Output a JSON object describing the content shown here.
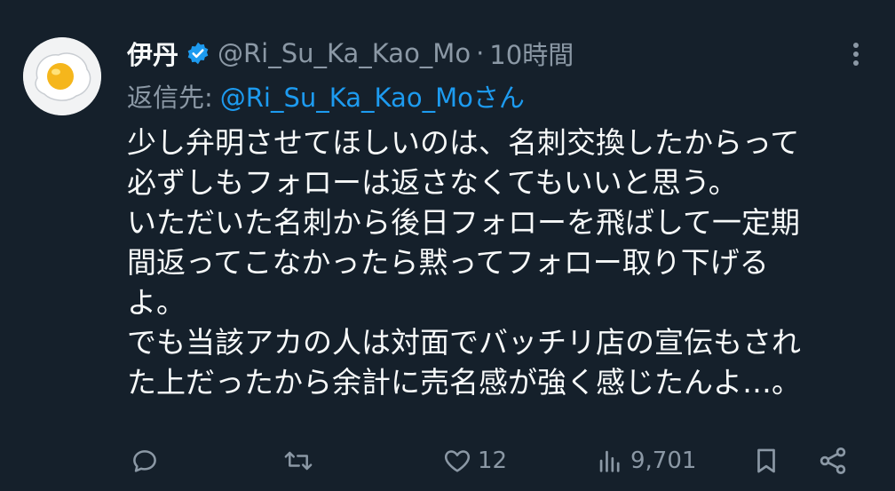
{
  "tweet": {
    "display_name": "伊丹",
    "verified_icon": "verified-badge-icon",
    "handle": "@Ri_Su_Ka_Kao_Mo",
    "separator": "·",
    "time": "10時間",
    "replying_label": "返信先:",
    "replying_handle": "@Ri_Su_Ka_Kao_Moさん",
    "body_lines": [
      "少し弁明させてほしいのは、名刺交換したからって",
      "必ずしもフォローは返さなくてもいいと思う。",
      "いただいた名刺から後日フォローを飛ばして一定期",
      "間返ってこなかったら黙ってフォロー取り下げる",
      "よ。",
      "でも当該アカの人は対面でバッチリ店の宣伝もされ",
      "た上だったから余計に売名感が強く感じたんよ…。"
    ],
    "counts": {
      "replies": "",
      "retweets": "",
      "likes": "12",
      "views": "9,701"
    }
  },
  "colors": {
    "background": "#15202b",
    "text": "#f7f9f9",
    "muted": "#8b98a5",
    "accent": "#1d9bf0"
  },
  "icons": {
    "more": "more-vertical-icon",
    "reply": "reply-icon",
    "retweet": "retweet-icon",
    "like": "heart-icon",
    "views": "views-chart-icon",
    "bookmark": "bookmark-icon",
    "share": "share-icon"
  }
}
